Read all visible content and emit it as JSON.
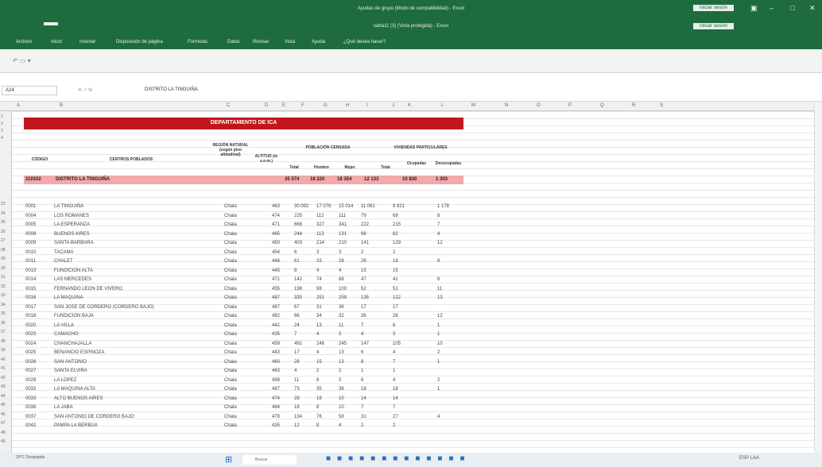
{
  "window": {
    "title": "Ayudas de grupo (Modo de compatibilidad) - Excel",
    "subtitle": "tabla11 (3) (Vista protegida) - Excel",
    "account": "Iniciar sesión"
  },
  "menu": {
    "items": [
      "Archivo",
      "Inicio",
      "Insertar",
      "Disposición de página",
      "Fórmulas",
      "Datos",
      "Revisar",
      "Vista",
      "Ayuda",
      "¿Qué desea hacer?"
    ]
  },
  "formula": {
    "namebox": "A24",
    "content": "DISTRITO LA TINGUIÑA"
  },
  "columns": [
    "A",
    "B",
    "C",
    "D",
    "E",
    "F",
    "G",
    "H",
    "I",
    "J",
    "K",
    "L",
    "M",
    "N",
    "O",
    "P",
    "Q",
    "R",
    "S"
  ],
  "rows": [
    "1",
    "2",
    "3",
    "4",
    "23",
    "24",
    "25",
    "26",
    "27",
    "28",
    "29",
    "30",
    "31",
    "32",
    "33",
    "34",
    "35",
    "36",
    "37",
    "38",
    "39",
    "40",
    "41",
    "42",
    "43",
    "44",
    "45",
    "46",
    "47",
    "48",
    "49"
  ],
  "sheet": {
    "title": "DEPARTAMENTO DE ICA",
    "headers": {
      "codigo": "CÓDIGO",
      "centros": "CENTROS POBLADOS",
      "region": "REGIÓN NATURAL (según piso altitudinal)",
      "altitud": "ALTITUD (m s.n.m.)",
      "poblacion": "POBLACIÓN CENSADA",
      "viviendas": "VIVIENDAS PARTICULARES",
      "total": "Total",
      "hombre": "Hombre",
      "mujer": "Mujer",
      "total_v": "Total",
      "ocupadas": "Ocupadas",
      "desocupadas": "Desocupadas"
    },
    "district": {
      "code": "110102",
      "name": "DISTRITO LA TINGUIÑA",
      "total": "35 574",
      "hombre": "18 220",
      "mujer": "18 354",
      "viv_total": "12 133",
      "ocupadas": "10 830",
      "desocupadas": "1 303"
    },
    "rows": [
      [
        "0001",
        "LA TINGUIÑA",
        "Chala",
        "463",
        "30 092",
        "17 078",
        "15 014",
        "11 061",
        "9 821",
        "1 178"
      ],
      [
        "0004",
        "LOS ROMANES",
        "Chala",
        "474",
        "225",
        "112",
        "111",
        "79",
        "69",
        "8"
      ],
      [
        "0005",
        "LA ESPERANZA",
        "Chala",
        "471",
        "668",
        "327",
        "341",
        "222",
        "215",
        "7"
      ],
      [
        "0008",
        "BUENOS AIRES",
        "Chala",
        "465",
        "244",
        "113",
        "131",
        "88",
        "82",
        "4"
      ],
      [
        "0009",
        "SANTA BARBARA",
        "Chala",
        "450",
        "403",
        "214",
        "210",
        "141",
        "129",
        "12"
      ],
      [
        "0010",
        "TACAMA",
        "Chala",
        "454",
        "6",
        "3",
        "3",
        "2",
        "2",
        ""
      ],
      [
        "0011",
        "CHALET",
        "Chala",
        "446",
        "61",
        "33",
        "28",
        "26",
        "18",
        "8"
      ],
      [
        "0013",
        "FUNDICION ALTA",
        "Chala",
        "445",
        "8",
        "4",
        "4",
        "15",
        "15",
        ""
      ],
      [
        "0014",
        "LAS MERCEDES",
        "Chala",
        "471",
        "142",
        "74",
        "68",
        "47",
        "41",
        "6"
      ],
      [
        "0015",
        "FERNANDO LEON DE VIVERO",
        "Chala",
        "455",
        "198",
        "98",
        "100",
        "52",
        "51",
        "11"
      ],
      [
        "0016",
        "LA MAQUINA",
        "Chala",
        "487",
        "330",
        "251",
        "259",
        "135",
        "122",
        "13"
      ],
      [
        "0017",
        "SAN JOSE DE CORDERO (CORDERO BAJO)",
        "Chala",
        "487",
        "67",
        "31",
        "36",
        "17",
        "17",
        ""
      ],
      [
        "0018",
        "FUNDICION BAJA",
        "Chala",
        "482",
        "66",
        "34",
        "32",
        "36",
        "28",
        "12"
      ],
      [
        "0020",
        "LA VILLA",
        "Chala",
        "442",
        "24",
        "13",
        "11",
        "7",
        "6",
        "1"
      ],
      [
        "0023",
        "CAMACHO",
        "Chala",
        "435",
        "7",
        "4",
        "3",
        "4",
        "3",
        "1"
      ],
      [
        "0024",
        "CHANCHAJALLA",
        "Chala",
        "459",
        "491",
        "246",
        "245",
        "147",
        "105",
        "10"
      ],
      [
        "0025",
        "BENANCIO ESPINOZA",
        "Chala",
        "443",
        "17",
        "4",
        "13",
        "6",
        "4",
        "2"
      ],
      [
        "0026",
        "SAN ANTONIO",
        "Chala",
        "460",
        "28",
        "15",
        "13",
        "8",
        "7",
        "1"
      ],
      [
        "0027",
        "SANTA ELVIRA",
        "Chala",
        "463",
        "4",
        "2",
        "2",
        "1",
        "1",
        ""
      ],
      [
        "0029",
        "LA LOPEZ",
        "Chala",
        "458",
        "11",
        "8",
        "3",
        "6",
        "4",
        "2"
      ],
      [
        "0032",
        "LA MAQUINA ALTA",
        "Chala",
        "487",
        "73",
        "35",
        "38",
        "18",
        "18",
        "1"
      ],
      [
        "0033",
        "ALTO BUENOS AIRES",
        "Chala",
        "474",
        "28",
        "18",
        "10",
        "14",
        "14",
        ""
      ],
      [
        "0036",
        "LA JABA",
        "Chala",
        "464",
        "18",
        "8",
        "10",
        "7",
        "7",
        ""
      ],
      [
        "0037",
        "SAN ANTONIO DE CORDERO BAJO",
        "Chala",
        "478",
        "134",
        "76",
        "58",
        "31",
        "27",
        "4"
      ],
      [
        "0042",
        "PAMPA LA BERBUA",
        "Chala",
        "435",
        "12",
        "8",
        "4",
        "2",
        "2",
        ""
      ]
    ]
  },
  "taskbar": {
    "weather": "20°C Despejado",
    "search": "Buscar",
    "tray": "ESP LAA"
  }
}
